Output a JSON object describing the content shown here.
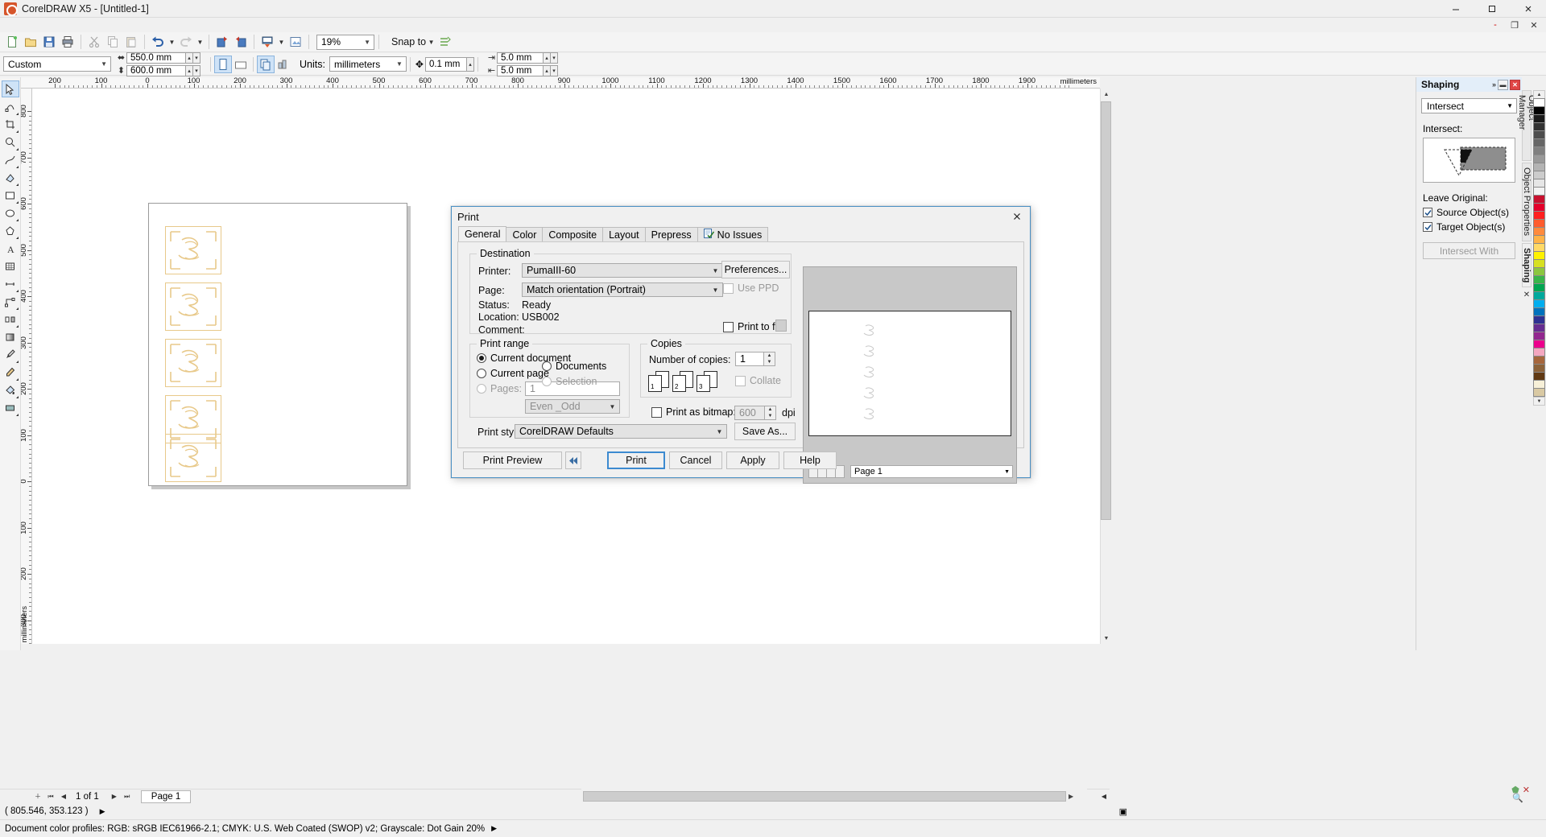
{
  "titlebar": {
    "app_title": "CorelDRAW X5 - [Untitled-1]",
    "icon": "coreldraw-logo-icon",
    "minimize": "minimize-icon",
    "maximize": "maximize-icon",
    "close": "close-icon"
  },
  "doc_window_buttons": {
    "minimize": "-",
    "restore": "❐",
    "close": "✕"
  },
  "toolbar": {
    "zoom_level": "19%",
    "snap_to_label": "Snap to",
    "icons": [
      "new-document-icon",
      "open-icon",
      "save-icon",
      "print-icon",
      "cut-icon",
      "copy-icon",
      "paste-icon",
      "undo-icon",
      "redo-icon",
      "import-icon",
      "export-icon",
      "publish-pdf-icon",
      "application-launcher-icon",
      "options-icon"
    ]
  },
  "propertybar": {
    "page_preset": "Custom",
    "page_width": "550.0 mm",
    "page_height": "600.0 mm",
    "units_label": "Units:",
    "units_value": "millimeters",
    "nudge_value": "0.1 mm",
    "duplicate_x": "5.0 mm",
    "duplicate_y": "5.0 mm",
    "orientation_portrait": "portrait-icon",
    "orientation_landscape": "landscape-icon",
    "all_pages_icon": "all-pages-icon",
    "current_page_icon": "current-page-icon"
  },
  "toolbox": [
    "pick-tool",
    "shape-tool",
    "crop-tool",
    "zoom-tool",
    "freehand-tool",
    "smart-fill-tool",
    "rectangle-tool",
    "ellipse-tool",
    "polygon-tool",
    "text-tool",
    "table-tool",
    "dimension-tool",
    "connector-tool",
    "blend-tool",
    "color-eyedropper-tool",
    "outline-tool",
    "fill-tool",
    "interactive-fill-tool"
  ],
  "rulers": {
    "unit_label": "millimeters",
    "h_labels": [
      "200",
      "100",
      "0",
      "100",
      "200",
      "300",
      "400",
      "500",
      "600",
      "700",
      "800",
      "900",
      "1000",
      "1100",
      "1200",
      "1300",
      "1400",
      "1500",
      "1600",
      "1700",
      "1800",
      "1900"
    ],
    "v_labels": [
      "800",
      "700",
      "600",
      "500",
      "400",
      "300",
      "200",
      "100",
      "0",
      "100",
      "200",
      "300"
    ]
  },
  "pagebar": {
    "first": "⏮",
    "prev": "◀",
    "count_label": "1 of 1",
    "next": "▶",
    "last": "⏭",
    "add_page": "+",
    "page_tab": "Page 1"
  },
  "coordbar": {
    "coords": "( 805.546, 353.123 )",
    "play_icon": "play-icon"
  },
  "statusbar": {
    "text": "Document color profiles: RGB: sRGB IEC61966-2.1; CMYK: U.S. Web Coated (SWOP) v2; Grayscale: Dot Gain 20%",
    "more_icon": "expand-icon",
    "snapshot_icon": "camera-icon",
    "fill_label": "fill-swatch",
    "outline_label": "outline-swatch"
  },
  "docker": {
    "title": "Shaping",
    "collapse_icon": "chevron-right-icon",
    "restore_icon": "restore-icon",
    "close_icon": "close-icon",
    "operation": "Intersect",
    "operation_label": "Intersect:",
    "leave_original_label": "Leave Original:",
    "checkboxes": [
      {
        "label": "Source Object(s)",
        "checked": true
      },
      {
        "label": "Target Object(s)",
        "checked": true
      }
    ],
    "action_button": "Intersect With",
    "action_disabled": true,
    "vertical_tabs": [
      "Object Manager",
      "Object Properties",
      "Shaping"
    ],
    "vertical_tab_active": "Shaping",
    "vertical_tab_close": "✕"
  },
  "palette": {
    "scroll_up": "▲",
    "scroll_down": "▼",
    "colors": [
      "#ffffff",
      "#000000",
      "#1a1a1a",
      "#333333",
      "#4d4d4d",
      "#666666",
      "#808080",
      "#999999",
      "#b3b3b3",
      "#cccccc",
      "#e6e6e6",
      "#f2f2f2",
      "#c8102e",
      "#e4002b",
      "#ff1f1f",
      "#ff5c2e",
      "#ff8a3d",
      "#ffb347",
      "#ffd966",
      "#fff200",
      "#d7e021",
      "#8cc63f",
      "#39b54a",
      "#00a651",
      "#00a99d",
      "#00aeef",
      "#0072bc",
      "#2e3192",
      "#662d91",
      "#92278f",
      "#ec008c",
      "#f4a7c0",
      "#a6663c",
      "#8c6239",
      "#603913",
      "#f7f0d8",
      "#d9c9a3"
    ]
  },
  "dialog": {
    "title": "Print",
    "close_icon": "close-icon",
    "tabs": [
      {
        "label": "General",
        "active": true
      },
      {
        "label": "Color",
        "active": false
      },
      {
        "label": "Composite",
        "active": false
      },
      {
        "label": "Layout",
        "active": false
      },
      {
        "label": "Prepress",
        "active": false
      },
      {
        "label": "No Issues",
        "active": false,
        "icon": "no-issues-icon"
      }
    ],
    "destination": {
      "legend": "Destination",
      "printer_label": "Printer:",
      "printer_value": "PumaIII-60",
      "page_label": "Page:",
      "page_value": "Match orientation (Portrait)",
      "status_label": "Status:",
      "status_value": "Ready",
      "location_label": "Location:",
      "location_value": "USB002",
      "comment_label": "Comment:",
      "comment_value": "",
      "preferences_button": "Preferences...",
      "use_ppd_label": "Use PPD",
      "use_ppd_checked": false,
      "use_ppd_disabled": true,
      "print_to_file_label": "Print to file",
      "print_to_file_checked": false,
      "print_to_file_more": "print-to-file-options-icon"
    },
    "print_range": {
      "legend": "Print range",
      "options": [
        {
          "label": "Current document",
          "selected": true,
          "disabled": false
        },
        {
          "label": "Documents",
          "selected": false,
          "disabled": false
        },
        {
          "label": "Current page",
          "selected": false,
          "disabled": false
        },
        {
          "label": "Selection",
          "selected": false,
          "disabled": true
        },
        {
          "label": "Pages:",
          "selected": false,
          "disabled": true
        }
      ],
      "pages_value": "1",
      "even_odd_value": "Even _Odd"
    },
    "copies": {
      "legend": "Copies",
      "number_label": "Number of copies:",
      "number_value": "1",
      "collate_label": "Collate",
      "collate_checked": false,
      "collate_disabled": true,
      "sheet_numbers": [
        "1",
        "2",
        "3"
      ],
      "print_as_bitmap_label": "Print as bitmap:",
      "print_as_bitmap_checked": false,
      "dpi_value": "600",
      "dpi_label": "dpi"
    },
    "print_style_label": "Print style:",
    "print_style_value": "CorelDRAW Defaults",
    "save_as_button": "Save As...",
    "footer": {
      "print_preview_button": "Print Preview",
      "collapse_icon": "collapse-preview-icon",
      "print_button": "Print",
      "cancel_button": "Cancel",
      "apply_button": "Apply",
      "help_button": "Help"
    },
    "preview": {
      "page_selector": "Page 1",
      "nav_buttons": [
        "first",
        "prev",
        "next",
        "last"
      ]
    }
  }
}
